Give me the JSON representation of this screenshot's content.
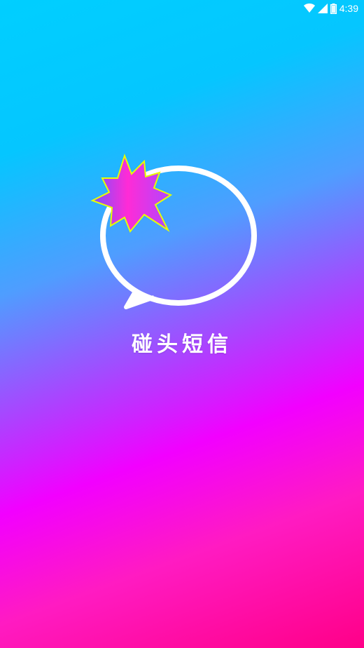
{
  "status_bar": {
    "time": "4:39",
    "icons": [
      "wifi-icon",
      "signal-icon",
      "battery-icon"
    ]
  },
  "splash": {
    "logo_icon": "chat-bubble-burst-icon",
    "title": "碰头短信"
  },
  "colors": {
    "gradient_top": "#00cfff",
    "gradient_mid": "#f200ff",
    "gradient_bottom": "#ff0088",
    "burst_fill_left": "#ff2bd6",
    "burst_fill_right": "#7a50ff",
    "burst_outline": "#e8ff00",
    "bubble_stroke": "#ffffff"
  }
}
